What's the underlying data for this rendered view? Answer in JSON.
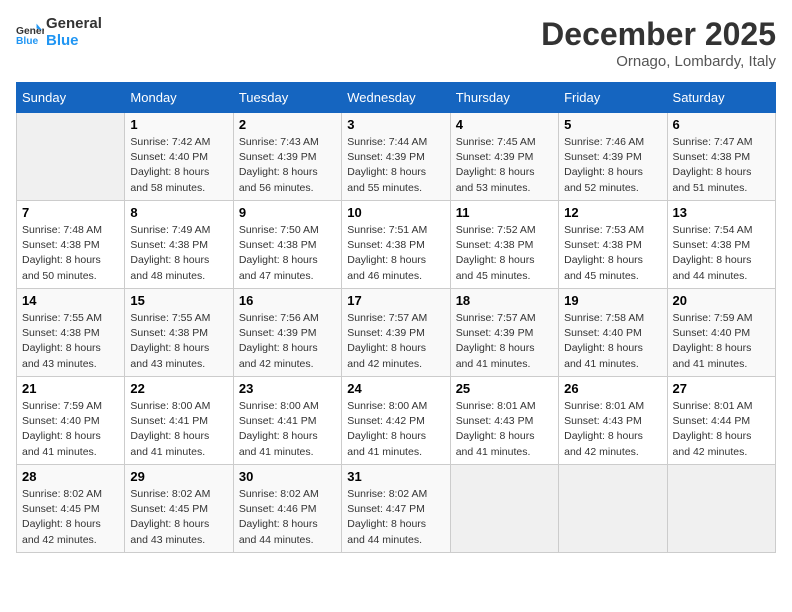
{
  "header": {
    "logo_line1": "General",
    "logo_line2": "Blue",
    "month": "December 2025",
    "location": "Ornago, Lombardy, Italy"
  },
  "weekdays": [
    "Sunday",
    "Monday",
    "Tuesday",
    "Wednesday",
    "Thursday",
    "Friday",
    "Saturday"
  ],
  "weeks": [
    [
      {
        "day": "",
        "sunrise": "",
        "sunset": "",
        "daylight": ""
      },
      {
        "day": "1",
        "sunrise": "Sunrise: 7:42 AM",
        "sunset": "Sunset: 4:40 PM",
        "daylight": "Daylight: 8 hours and 58 minutes."
      },
      {
        "day": "2",
        "sunrise": "Sunrise: 7:43 AM",
        "sunset": "Sunset: 4:39 PM",
        "daylight": "Daylight: 8 hours and 56 minutes."
      },
      {
        "day": "3",
        "sunrise": "Sunrise: 7:44 AM",
        "sunset": "Sunset: 4:39 PM",
        "daylight": "Daylight: 8 hours and 55 minutes."
      },
      {
        "day": "4",
        "sunrise": "Sunrise: 7:45 AM",
        "sunset": "Sunset: 4:39 PM",
        "daylight": "Daylight: 8 hours and 53 minutes."
      },
      {
        "day": "5",
        "sunrise": "Sunrise: 7:46 AM",
        "sunset": "Sunset: 4:39 PM",
        "daylight": "Daylight: 8 hours and 52 minutes."
      },
      {
        "day": "6",
        "sunrise": "Sunrise: 7:47 AM",
        "sunset": "Sunset: 4:38 PM",
        "daylight": "Daylight: 8 hours and 51 minutes."
      }
    ],
    [
      {
        "day": "7",
        "sunrise": "Sunrise: 7:48 AM",
        "sunset": "Sunset: 4:38 PM",
        "daylight": "Daylight: 8 hours and 50 minutes."
      },
      {
        "day": "8",
        "sunrise": "Sunrise: 7:49 AM",
        "sunset": "Sunset: 4:38 PM",
        "daylight": "Daylight: 8 hours and 48 minutes."
      },
      {
        "day": "9",
        "sunrise": "Sunrise: 7:50 AM",
        "sunset": "Sunset: 4:38 PM",
        "daylight": "Daylight: 8 hours and 47 minutes."
      },
      {
        "day": "10",
        "sunrise": "Sunrise: 7:51 AM",
        "sunset": "Sunset: 4:38 PM",
        "daylight": "Daylight: 8 hours and 46 minutes."
      },
      {
        "day": "11",
        "sunrise": "Sunrise: 7:52 AM",
        "sunset": "Sunset: 4:38 PM",
        "daylight": "Daylight: 8 hours and 45 minutes."
      },
      {
        "day": "12",
        "sunrise": "Sunrise: 7:53 AM",
        "sunset": "Sunset: 4:38 PM",
        "daylight": "Daylight: 8 hours and 45 minutes."
      },
      {
        "day": "13",
        "sunrise": "Sunrise: 7:54 AM",
        "sunset": "Sunset: 4:38 PM",
        "daylight": "Daylight: 8 hours and 44 minutes."
      }
    ],
    [
      {
        "day": "14",
        "sunrise": "Sunrise: 7:55 AM",
        "sunset": "Sunset: 4:38 PM",
        "daylight": "Daylight: 8 hours and 43 minutes."
      },
      {
        "day": "15",
        "sunrise": "Sunrise: 7:55 AM",
        "sunset": "Sunset: 4:38 PM",
        "daylight": "Daylight: 8 hours and 43 minutes."
      },
      {
        "day": "16",
        "sunrise": "Sunrise: 7:56 AM",
        "sunset": "Sunset: 4:39 PM",
        "daylight": "Daylight: 8 hours and 42 minutes."
      },
      {
        "day": "17",
        "sunrise": "Sunrise: 7:57 AM",
        "sunset": "Sunset: 4:39 PM",
        "daylight": "Daylight: 8 hours and 42 minutes."
      },
      {
        "day": "18",
        "sunrise": "Sunrise: 7:57 AM",
        "sunset": "Sunset: 4:39 PM",
        "daylight": "Daylight: 8 hours and 41 minutes."
      },
      {
        "day": "19",
        "sunrise": "Sunrise: 7:58 AM",
        "sunset": "Sunset: 4:40 PM",
        "daylight": "Daylight: 8 hours and 41 minutes."
      },
      {
        "day": "20",
        "sunrise": "Sunrise: 7:59 AM",
        "sunset": "Sunset: 4:40 PM",
        "daylight": "Daylight: 8 hours and 41 minutes."
      }
    ],
    [
      {
        "day": "21",
        "sunrise": "Sunrise: 7:59 AM",
        "sunset": "Sunset: 4:40 PM",
        "daylight": "Daylight: 8 hours and 41 minutes."
      },
      {
        "day": "22",
        "sunrise": "Sunrise: 8:00 AM",
        "sunset": "Sunset: 4:41 PM",
        "daylight": "Daylight: 8 hours and 41 minutes."
      },
      {
        "day": "23",
        "sunrise": "Sunrise: 8:00 AM",
        "sunset": "Sunset: 4:41 PM",
        "daylight": "Daylight: 8 hours and 41 minutes."
      },
      {
        "day": "24",
        "sunrise": "Sunrise: 8:00 AM",
        "sunset": "Sunset: 4:42 PM",
        "daylight": "Daylight: 8 hours and 41 minutes."
      },
      {
        "day": "25",
        "sunrise": "Sunrise: 8:01 AM",
        "sunset": "Sunset: 4:43 PM",
        "daylight": "Daylight: 8 hours and 41 minutes."
      },
      {
        "day": "26",
        "sunrise": "Sunrise: 8:01 AM",
        "sunset": "Sunset: 4:43 PM",
        "daylight": "Daylight: 8 hours and 42 minutes."
      },
      {
        "day": "27",
        "sunrise": "Sunrise: 8:01 AM",
        "sunset": "Sunset: 4:44 PM",
        "daylight": "Daylight: 8 hours and 42 minutes."
      }
    ],
    [
      {
        "day": "28",
        "sunrise": "Sunrise: 8:02 AM",
        "sunset": "Sunset: 4:45 PM",
        "daylight": "Daylight: 8 hours and 42 minutes."
      },
      {
        "day": "29",
        "sunrise": "Sunrise: 8:02 AM",
        "sunset": "Sunset: 4:45 PM",
        "daylight": "Daylight: 8 hours and 43 minutes."
      },
      {
        "day": "30",
        "sunrise": "Sunrise: 8:02 AM",
        "sunset": "Sunset: 4:46 PM",
        "daylight": "Daylight: 8 hours and 44 minutes."
      },
      {
        "day": "31",
        "sunrise": "Sunrise: 8:02 AM",
        "sunset": "Sunset: 4:47 PM",
        "daylight": "Daylight: 8 hours and 44 minutes."
      },
      {
        "day": "",
        "sunrise": "",
        "sunset": "",
        "daylight": ""
      },
      {
        "day": "",
        "sunrise": "",
        "sunset": "",
        "daylight": ""
      },
      {
        "day": "",
        "sunrise": "",
        "sunset": "",
        "daylight": ""
      }
    ]
  ]
}
